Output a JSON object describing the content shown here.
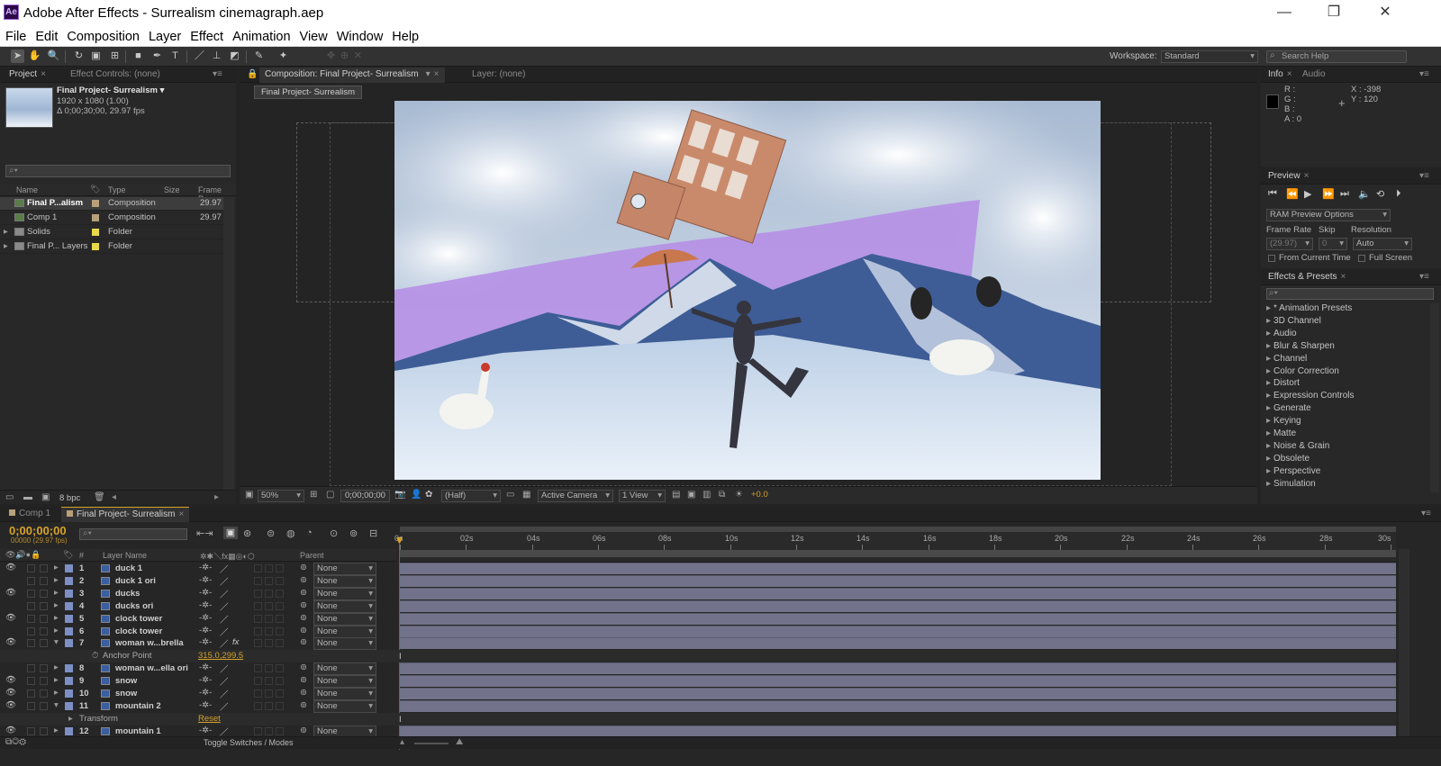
{
  "app": {
    "title": "Adobe After Effects - Surrealism cinemagraph.aep",
    "logo_text": "Ae"
  },
  "window_controls": {
    "minimize": "—",
    "maximize": "❐",
    "close": "✕"
  },
  "menu": [
    "File",
    "Edit",
    "Composition",
    "Layer",
    "Effect",
    "Animation",
    "View",
    "Window",
    "Help"
  ],
  "toolbar": {
    "workspace_label": "Workspace:",
    "workspace_value": "Standard",
    "search_help_placeholder": "Search Help"
  },
  "project_panel": {
    "tabs": [
      "Project",
      "Effect Controls: (none)"
    ],
    "selected_name": "Final Project- Surrealism ▾",
    "selected_dims": "1920 x 1080 (1.00)",
    "selected_duration": "Δ 0;00;30;00, 29.97 fps",
    "columns": [
      "Name",
      "Type",
      "Size",
      "Frame R..."
    ],
    "items": [
      {
        "name": "Final P...alism",
        "type": "Composition",
        "fps": "29.97",
        "swatch": "#b8a07a",
        "kind": "comp"
      },
      {
        "name": "Comp 1",
        "type": "Composition",
        "fps": "29.97",
        "swatch": "#b8a07a",
        "kind": "comp"
      },
      {
        "name": "Solids",
        "type": "Folder",
        "fps": "",
        "swatch": "#e8d84a",
        "kind": "folder"
      },
      {
        "name": "Final P... Layers",
        "type": "Folder",
        "fps": "",
        "swatch": "#e8d84a",
        "kind": "folder"
      }
    ],
    "bpc": "8 bpc"
  },
  "comp_panel": {
    "tab": "Composition: Final Project- Surrealism",
    "layer_tab": "Layer: (none)",
    "breadcrumb": "Final Project- Surrealism",
    "zoom": "50%",
    "timecode": "0;00;00;00",
    "resolution": "(Half)",
    "camera": "Active Camera",
    "views": "1 View",
    "exposure": "+0.0"
  },
  "info_panel": {
    "tabs": [
      "Info",
      "Audio"
    ],
    "r": "R :",
    "g": "G :",
    "b": "B :",
    "a": "A : 0",
    "x": "X : -398",
    "y": "Y : 120"
  },
  "preview_panel": {
    "tab": "Preview",
    "ram_options": "RAM Preview Options",
    "frame_rate_label": "Frame Rate",
    "skip_label": "Skip",
    "resolution_label": "Resolution",
    "frame_rate": "(29.97)",
    "skip": "0",
    "resolution": "Auto",
    "from_current": "From Current Time",
    "full_screen": "Full Screen"
  },
  "effects_panel": {
    "tab": "Effects & Presets",
    "items": [
      "* Animation Presets",
      "3D Channel",
      "Audio",
      "Blur & Sharpen",
      "Channel",
      "Color Correction",
      "Distort",
      "Expression Controls",
      "Generate",
      "Keying",
      "Matte",
      "Noise & Grain",
      "Obsolete",
      "Perspective",
      "Simulation"
    ]
  },
  "timeline": {
    "tabs": [
      "Comp 1",
      "Final Project- Surrealism"
    ],
    "timecode": "0;00;00;00",
    "frame_info": "00000 (29.97 fps)",
    "col_layer_name": "Layer Name",
    "col_parent": "Parent",
    "col_num": "#",
    "ruler": [
      "0s",
      "02s",
      "04s",
      "06s",
      "08s",
      "10s",
      "12s",
      "14s",
      "16s",
      "18s",
      "20s",
      "22s",
      "24s",
      "26s",
      "28s",
      "30s"
    ],
    "toggle_label": "Toggle Switches / Modes",
    "rows": [
      {
        "type": "layer",
        "num": "1",
        "name": "duck 1",
        "parent": "None",
        "eye": true,
        "expanded": false
      },
      {
        "type": "layer",
        "num": "2",
        "name": "duck 1 ori",
        "parent": "None",
        "eye": false,
        "expanded": false
      },
      {
        "type": "layer",
        "num": "3",
        "name": "ducks",
        "parent": "None",
        "eye": true,
        "expanded": false
      },
      {
        "type": "layer",
        "num": "4",
        "name": "ducks ori",
        "parent": "None",
        "eye": false,
        "expanded": false
      },
      {
        "type": "layer",
        "num": "5",
        "name": "clock tower",
        "parent": "None",
        "eye": true,
        "expanded": false
      },
      {
        "type": "layer",
        "num": "6",
        "name": "clock tower",
        "parent": "None",
        "eye": false,
        "expanded": false
      },
      {
        "type": "layer",
        "num": "7",
        "name": "woman w...brella",
        "parent": "None",
        "eye": true,
        "expanded": true,
        "fx": true
      },
      {
        "type": "prop",
        "name": "Anchor Point",
        "value": "315.0,299.5"
      },
      {
        "type": "layer",
        "num": "8",
        "name": "woman w...ella ori",
        "parent": "None",
        "eye": false,
        "expanded": false
      },
      {
        "type": "layer",
        "num": "9",
        "name": "snow",
        "parent": "None",
        "eye": true,
        "expanded": false
      },
      {
        "type": "layer",
        "num": "10",
        "name": "snow",
        "parent": "None",
        "eye": true,
        "expanded": false
      },
      {
        "type": "layer",
        "num": "11",
        "name": "mountain 2",
        "parent": "None",
        "eye": true,
        "expanded": true
      },
      {
        "type": "prop",
        "name": "Transform",
        "value": "Reset"
      },
      {
        "type": "layer",
        "num": "12",
        "name": "mountain 1",
        "parent": "None",
        "eye": true,
        "expanded": false
      }
    ]
  }
}
